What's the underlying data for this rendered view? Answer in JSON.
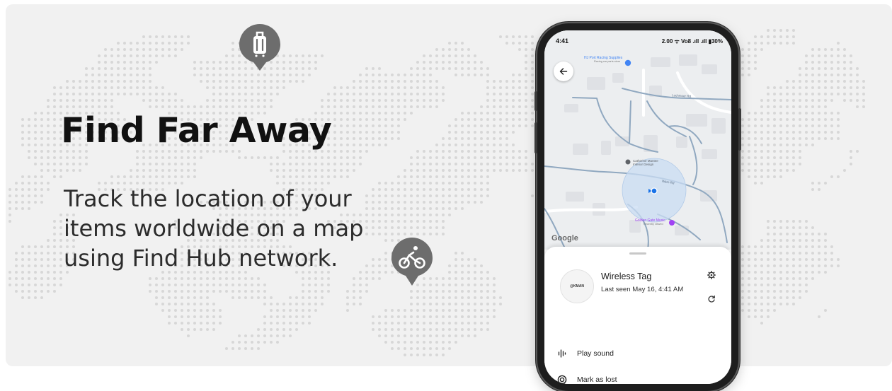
{
  "hero": {
    "title": "Find Far Away",
    "lines": [
      "Track the location of your",
      "items worldwide on a map",
      "using Find Hub network."
    ]
  },
  "pins": [
    {
      "icon": "luggage-icon"
    },
    {
      "icon": "bicycle-icon"
    }
  ],
  "phone": {
    "status_bar": {
      "time": "4:41",
      "right": "2.00 ᯤ Vo8 .ıll .ıll ▮30%"
    },
    "map": {
      "business_label": "HJ Port Racing Supplies",
      "business_sub": "Racing car parts store",
      "street_label": "Lochmoor Rd",
      "place_label": "Catherine Mantee Interior Design",
      "music_label": "Golden Gate Music",
      "music_sub": "Recently viewed",
      "street_label_2": "Ware Rd",
      "google": "Google"
    },
    "device": {
      "brand": "@KMAN",
      "name": "Wireless Tag",
      "last_seen": "Last seen May 16, 4:41 AM"
    },
    "actions": [
      {
        "label": "Play sound",
        "icon": "sound-wave-icon"
      },
      {
        "label": "Mark as lost",
        "icon": "mark-lost-icon"
      }
    ]
  },
  "colors": {
    "background": "#f1f1f1",
    "pin": "#6d6d6d",
    "accuracy_circle": "#c9dcf3",
    "location_dot": "#1a73e8"
  }
}
